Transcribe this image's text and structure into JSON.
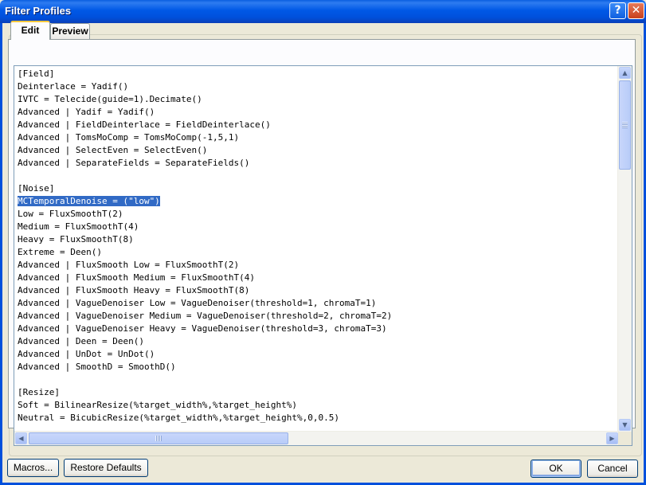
{
  "window": {
    "title": "Filter Profiles",
    "help_label": "?",
    "close_label": "✕"
  },
  "tabs": [
    {
      "label": "Edit",
      "active": true
    },
    {
      "label": "Preview",
      "active": false
    }
  ],
  "editor": {
    "selected_line_index": 10,
    "lines": [
      "[Field]",
      "Deinterlace = Yadif()",
      "IVTC = Telecide(guide=1).Decimate()",
      "Advanced | Yadif = Yadif()",
      "Advanced | FieldDeinterlace = FieldDeinterlace()",
      "Advanced | TomsMoComp = TomsMoComp(-1,5,1)",
      "Advanced | SelectEven = SelectEven()",
      "Advanced | SeparateFields = SeparateFields()",
      "",
      "[Noise]",
      "MCTemporalDenoise = (\"low\")",
      "Low = FluxSmoothT(2)",
      "Medium = FluxSmoothT(4)",
      "Heavy = FluxSmoothT(8)",
      "Extreme = Deen()",
      "Advanced | FluxSmooth Low = FluxSmoothT(2)",
      "Advanced | FluxSmooth Medium = FluxSmoothT(4)",
      "Advanced | FluxSmooth Heavy = FluxSmoothT(8)",
      "Advanced | VagueDenoiser Low = VagueDenoiser(threshold=1, chromaT=1)",
      "Advanced | VagueDenoiser Medium = VagueDenoiser(threshold=2, chromaT=2)",
      "Advanced | VagueDenoiser Heavy = VagueDenoiser(threshold=3, chromaT=3)",
      "Advanced | Deen = Deen()",
      "Advanced | UnDot = UnDot()",
      "Advanced | SmoothD = SmoothD()",
      "",
      "[Resize]",
      "Soft = BilinearResize(%target_width%,%target_height%)",
      "Neutral = BicubicResize(%target_width%,%target_height%,0,0.5)"
    ]
  },
  "scrollbar_icons": {
    "up": "▲",
    "down": "▼",
    "left": "◀",
    "right": "▶"
  },
  "buttons": {
    "macros": "Macros...",
    "restore_defaults": "Restore Defaults",
    "ok": "OK",
    "cancel": "Cancel"
  }
}
